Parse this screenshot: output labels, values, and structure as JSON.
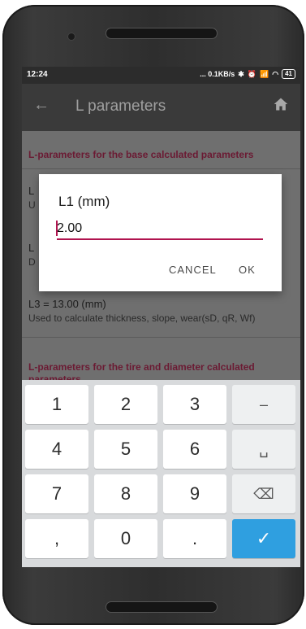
{
  "status_bar": {
    "time": "12:24",
    "network_speed": "... 0.1KB/s",
    "battery": "41"
  },
  "app_bar": {
    "title": "L parameters",
    "back_icon": "arrow-left-icon",
    "home_icon": "home-icon"
  },
  "sections": [
    {
      "title": "L-parameters for the base calculated parameters"
    },
    {
      "title": "L-parameters for the tire and diameter calculated parameters"
    }
  ],
  "params": [
    {
      "title": "L",
      "desc": "U"
    },
    {
      "title": "L",
      "desc": "D"
    },
    {
      "title": "L3 = 13.00 (mm)",
      "desc": "Used to calculate thickness, slope, wear(sD, qR, Wf)"
    }
  ],
  "dialog": {
    "title": "L1 (mm)",
    "value": "2.00",
    "cancel": "CANCEL",
    "ok": "OK"
  },
  "keyboard": {
    "keys": [
      [
        "1",
        "2",
        "3",
        "–"
      ],
      [
        "4",
        "5",
        "6",
        "␣"
      ],
      [
        "7",
        "8",
        "9",
        "⌫"
      ],
      [
        ",",
        "0",
        ".",
        "✓"
      ]
    ]
  },
  "colors": {
    "accent": "#b0144f",
    "done_key": "#2f9fe0"
  }
}
